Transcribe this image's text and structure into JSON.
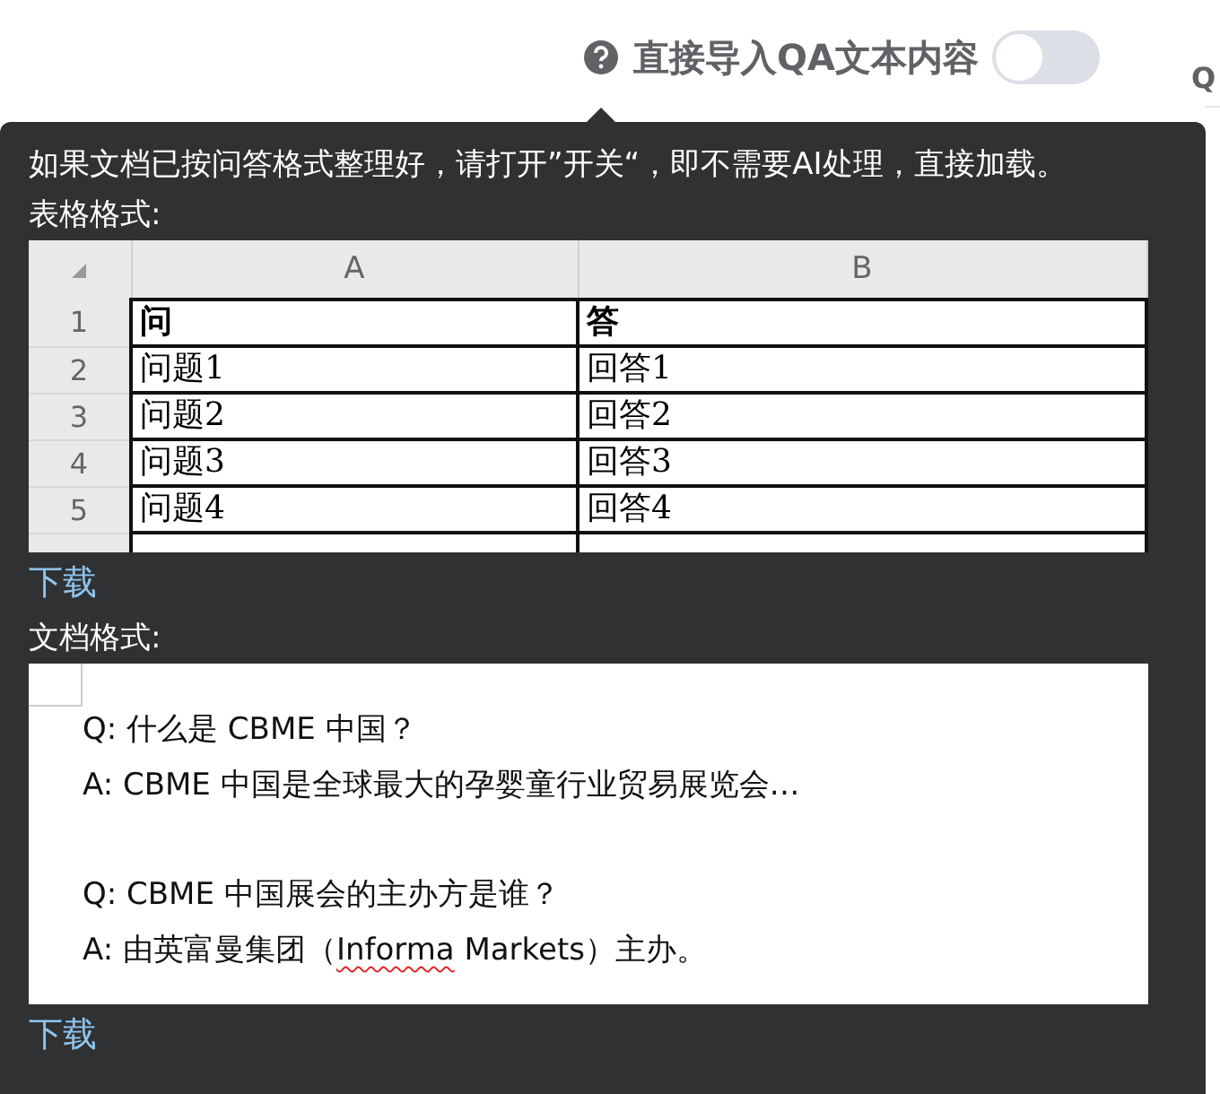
{
  "header": {
    "label": "直接导入QA文本内容",
    "toggle": {
      "on": false
    },
    "cut_tab": "Q"
  },
  "tooltip": {
    "intro": "如果文档已按问答格式整理好，请打开”开关“，即不需要AI处理，直接加载。",
    "table_label": "表格格式:",
    "sheet": {
      "columns": [
        "A",
        "B"
      ],
      "rows": [
        {
          "number": "1",
          "cells": [
            "问",
            "答"
          ],
          "bold": true
        },
        {
          "number": "2",
          "cells": [
            "问题1",
            "回答1"
          ],
          "bold": false
        },
        {
          "number": "3",
          "cells": [
            "问题2",
            "回答2"
          ],
          "bold": false
        },
        {
          "number": "4",
          "cells": [
            "问题3",
            "回答3"
          ],
          "bold": false
        },
        {
          "number": "5",
          "cells": [
            "问题4",
            "回答4"
          ],
          "bold": false
        }
      ]
    },
    "table_download": "下载",
    "doc_label": "文档格式:",
    "qa_pairs": [
      {
        "question": [
          {
            "text": "Q:  什么是 CBME 中国？",
            "misspelled": false
          }
        ],
        "answer": [
          {
            "text": "A: CBME 中国是全球最大的孕婴童行业贸易展览会…",
            "misspelled": false
          }
        ]
      },
      {
        "question": [
          {
            "text": "Q: CBME 中国展会的主办方是谁？",
            "misspelled": false
          }
        ],
        "answer": [
          {
            "text": "A:  由英富曼集团（",
            "misspelled": false
          },
          {
            "text": "Informa",
            "misspelled": true
          },
          {
            "text": " Markets）主办。",
            "misspelled": false
          }
        ]
      }
    ],
    "doc_download": "下载"
  }
}
